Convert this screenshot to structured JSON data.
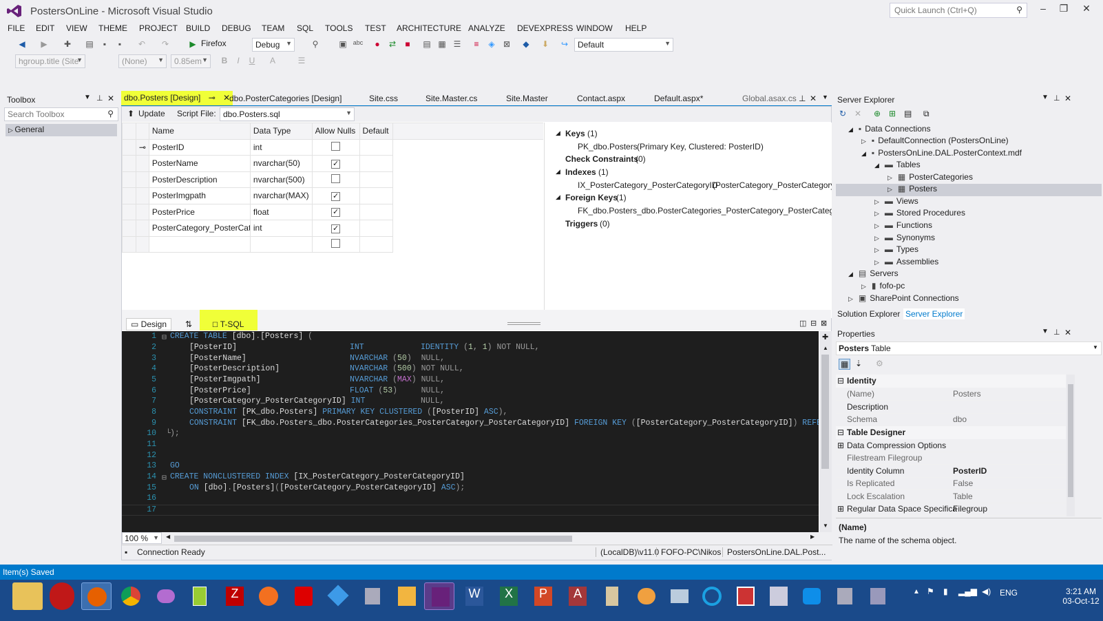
{
  "window": {
    "title": "PostersOnLine - Microsoft Visual Studio",
    "quick_launch": "Quick Launch (Ctrl+Q)"
  },
  "menu": [
    "FILE",
    "EDIT",
    "VIEW",
    "THEME",
    "PROJECT",
    "BUILD",
    "DEBUG",
    "TEAM",
    "SQL",
    "TOOLS",
    "TEST",
    "ARCHITECTURE",
    "ANALYZE",
    "DEVEXPRESS",
    "WINDOW",
    "HELP"
  ],
  "toolbar": {
    "browser": "Firefox",
    "config": "Debug",
    "scheme": "Default",
    "style_combo": "hgroup.title (Site",
    "font_combo": "(None)",
    "size_combo": "0.85em"
  },
  "toolbox": {
    "title": "Toolbox",
    "search_placeholder": "Search Toolbox",
    "group": "General"
  },
  "tabs": [
    "dbo.Posters [Design]",
    "dbo.PosterCategories [Design]",
    "Site.css",
    "Site.Master.cs",
    "Site.Master",
    "Contact.aspx",
    "Default.aspx*",
    "Global.asax.cs"
  ],
  "designer": {
    "update_label": "Update",
    "script_file_label": "Script File:",
    "script_file": "dbo.Posters.sql",
    "columns": [
      "Name",
      "Data Type",
      "Allow Nulls",
      "Default"
    ],
    "rows": [
      {
        "name": "PosterID",
        "type": "int",
        "nulls": false,
        "key": true
      },
      {
        "name": "PosterName",
        "type": "nvarchar(50)",
        "nulls": true
      },
      {
        "name": "PosterDescription",
        "type": "nvarchar(500)",
        "nulls": false
      },
      {
        "name": "PosterImgpath",
        "type": "nvarchar(MAX)",
        "nulls": true
      },
      {
        "name": "PosterPrice",
        "type": "float",
        "nulls": true
      },
      {
        "name": "PosterCategory_PosterCate",
        "type": "int",
        "nulls": true
      },
      {
        "name": "",
        "type": "",
        "nulls": false
      }
    ],
    "keys_label": "Keys",
    "keys_count": "(1)",
    "key_item": "PK_dbo.Posters",
    "key_detail": "(Primary Key, Clustered: PosterID)",
    "check_label": "Check Constraints",
    "check_count": "(0)",
    "indexes_label": "Indexes",
    "indexes_count": "(1)",
    "index_item": "IX_PosterCategory_PosterCategoryID",
    "index_detail": "(PosterCategory_PosterCategoryI",
    "fk_label": "Foreign Keys",
    "fk_count": "(1)",
    "fk_item": "FK_dbo.Posters_dbo.PosterCategories_PosterCategory_PosterCategoryI",
    "triggers_label": "Triggers",
    "triggers_count": "(0)",
    "design_tab": "Design",
    "tsql_tab": "T-SQL",
    "zoom": "100 %",
    "status": "Connection Ready",
    "server": "(LocalDB)\\v11.0",
    "user": "FOFO-PC\\Nikos",
    "db": "PostersOnLine.DAL.Post..."
  },
  "server_explorer": {
    "title": "Server Explorer",
    "nodes": [
      "Data Connections",
      "DefaultConnection (PostersOnLine)",
      "PostersOnLine.DAL.PosterContext.mdf",
      "Tables",
      "PosterCategories",
      "Posters",
      "Views",
      "Stored Procedures",
      "Functions",
      "Synonyms",
      "Types",
      "Assemblies",
      "Servers",
      "fofo-pc",
      "SharePoint Connections"
    ],
    "bottom_tabs": [
      "Solution Explorer",
      "Server Explorer"
    ]
  },
  "properties": {
    "title": "Properties",
    "object": "Posters",
    "object_type": "Table",
    "cat_identity": "Identity",
    "cat_designer": "Table Designer",
    "rows": [
      {
        "k": "(Name)",
        "v": "Posters"
      },
      {
        "k": "Description",
        "v": ""
      },
      {
        "k": "Schema",
        "v": "dbo"
      },
      {
        "k": "Data Compression Options",
        "v": ""
      },
      {
        "k": "Filestream Filegroup",
        "v": ""
      },
      {
        "k": "Identity Column",
        "v": "PosterID"
      },
      {
        "k": "Is Replicated",
        "v": "False"
      },
      {
        "k": "Lock Escalation",
        "v": "Table"
      },
      {
        "k": "Regular Data Space Specifica",
        "v": "Filegroup"
      }
    ],
    "desc_title": "(Name)",
    "desc_text": "The name of the schema object."
  },
  "status_bar": "Item(s) Saved",
  "clock": {
    "time": "3:21 AM",
    "date": "03-Oct-12",
    "lang": "ENG"
  }
}
